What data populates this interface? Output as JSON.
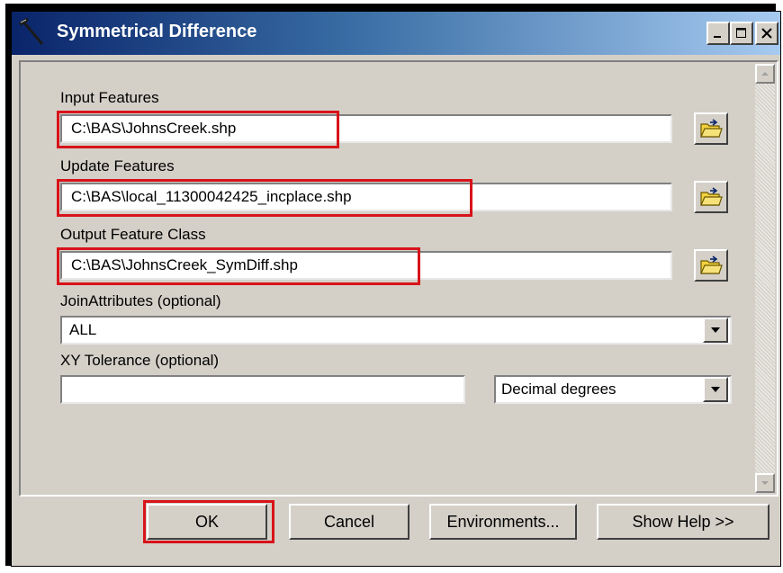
{
  "window": {
    "title": "Symmetrical Difference",
    "controls": {
      "minimize": "minimize-icon",
      "maximize": "maximize-icon",
      "close": "close-icon"
    }
  },
  "form": {
    "input_features": {
      "label": "Input Features",
      "value": "C:\\BAS\\JohnsCreek.shp"
    },
    "update_features": {
      "label": "Update Features",
      "value": "C:\\BAS\\local_11300042425_incplace.shp"
    },
    "output_feature_class": {
      "label": "Output Feature Class",
      "value": "C:\\BAS\\JohnsCreek_SymDiff.shp"
    },
    "join_attributes": {
      "label": "JoinAttributes (optional)",
      "value": "ALL"
    },
    "xy_tolerance": {
      "label": "XY Tolerance (optional)",
      "value": "",
      "unit": "Decimal degrees"
    }
  },
  "buttons": {
    "ok": "OK",
    "cancel": "Cancel",
    "environments": "Environments...",
    "show_help": "Show Help >>"
  },
  "colors": {
    "highlight": "#d8131a",
    "titlebar_start": "#0a246a",
    "titlebar_end": "#a6caf0",
    "dialog_face": "#d4d0c8"
  },
  "icons": {
    "app": "tool-hammer-icon",
    "browse": "open-folder-icon",
    "dropdown": "chevron-down-icon",
    "scroll_up": "scroll-up-icon",
    "scroll_down": "scroll-down-icon"
  }
}
